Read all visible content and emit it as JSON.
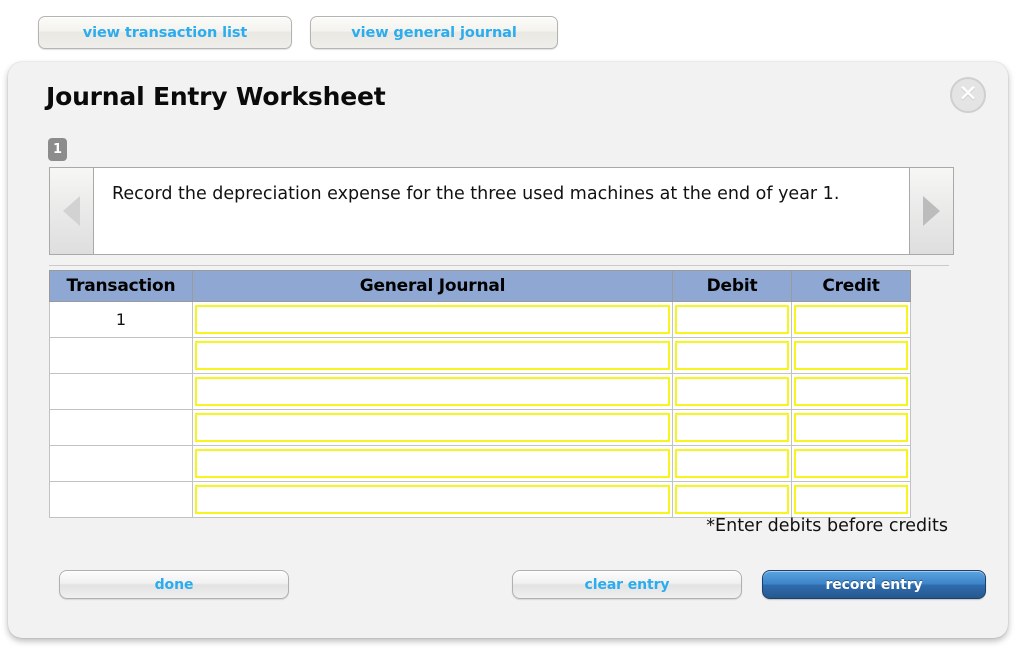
{
  "toolbar": {
    "view_transaction_list": "view transaction list",
    "view_general_journal": "view general journal"
  },
  "panel": {
    "title": "Journal Entry Worksheet",
    "close_label": "✕",
    "step_badge": "1",
    "prompt": "Record the depreciation expense for the three used machines at the end of year 1.",
    "prev_label": "previous",
    "next_label": "next"
  },
  "table": {
    "headers": [
      "Transaction",
      "General Journal",
      "Debit",
      "Credit"
    ],
    "rows": [
      {
        "transaction": "1",
        "journal": "",
        "debit": "",
        "credit": ""
      },
      {
        "transaction": "",
        "journal": "",
        "debit": "",
        "credit": ""
      },
      {
        "transaction": "",
        "journal": "",
        "debit": "",
        "credit": ""
      },
      {
        "transaction": "",
        "journal": "",
        "debit": "",
        "credit": ""
      },
      {
        "transaction": "",
        "journal": "",
        "debit": "",
        "credit": ""
      },
      {
        "transaction": "",
        "journal": "",
        "debit": "",
        "credit": ""
      }
    ],
    "footnote": "*Enter debits before credits"
  },
  "footer": {
    "done": "done",
    "clear_entry": "clear entry",
    "record_entry": "record entry"
  },
  "colors": {
    "panel_bg": "#f2f2f2",
    "header_blue": "#8fa8d3",
    "input_yellow": "#f7f520",
    "link_blue": "#2bacee",
    "primary_blue": "#3d84c9"
  }
}
